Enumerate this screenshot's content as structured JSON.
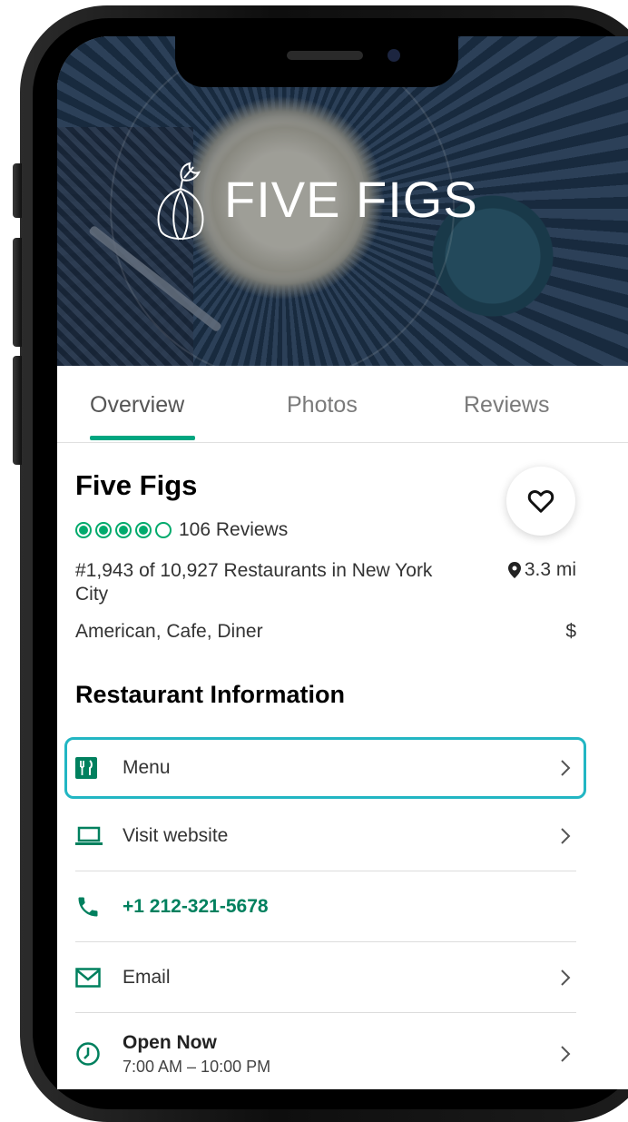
{
  "hero": {
    "logo_text": "FIVE FIGS"
  },
  "tabs": [
    {
      "label": "Overview",
      "active": true
    },
    {
      "label": "Photos",
      "active": false
    },
    {
      "label": "Reviews",
      "active": false
    }
  ],
  "restaurant": {
    "name": "Five Figs",
    "rating": 4,
    "rating_max": 5,
    "reviews_text": "106 Reviews",
    "rank_text": "#1,943 of 10,927 Restaurants in New York City",
    "distance": "3.3 mi",
    "cuisine": "American, Cafe, Diner",
    "price": "$"
  },
  "info": {
    "section_title": "Restaurant Information",
    "menu_label": "Menu",
    "website_label": "Visit website",
    "phone": "+1 212-321-5678",
    "email_label": "Email",
    "hours_status": "Open Now",
    "hours_range": "7:00 AM – 10:00 PM"
  },
  "colors": {
    "accent": "#00a680",
    "rating": "#00aa6c",
    "highlight": "#22b6c3",
    "phone_text": "#00805e"
  },
  "icons": [
    "fig-logo-icon",
    "heart-icon",
    "map-pin-icon",
    "menu-utensils-icon",
    "laptop-icon",
    "phone-icon",
    "email-icon",
    "clock-icon",
    "chevron-right-icon"
  ]
}
